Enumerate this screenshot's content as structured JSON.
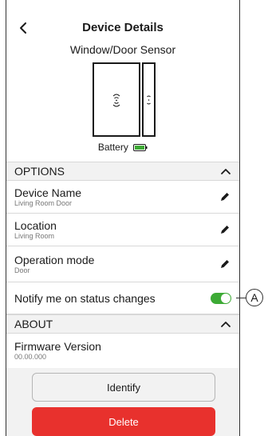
{
  "header": {
    "title": "Device Details",
    "subtitle": "Window/Door Sensor"
  },
  "device": {
    "battery_label": "Battery"
  },
  "options": {
    "section_label": "OPTIONS",
    "device_name": {
      "label": "Device Name",
      "value": "Living Room Door"
    },
    "location": {
      "label": "Location",
      "value": "Living Room"
    },
    "operation_mode": {
      "label": "Operation mode",
      "value": "Door"
    },
    "notify": {
      "label": "Notify me on status changes",
      "enabled": true
    }
  },
  "about": {
    "section_label": "ABOUT",
    "firmware": {
      "label": "Firmware Version",
      "value": "00.00.000"
    }
  },
  "actions": {
    "identify_label": "Identify",
    "delete_label": "Delete"
  },
  "callout": {
    "label": "A"
  },
  "colors": {
    "toggle_on": "#3daa35",
    "delete": "#e8312d",
    "battery": "#3daa35"
  }
}
